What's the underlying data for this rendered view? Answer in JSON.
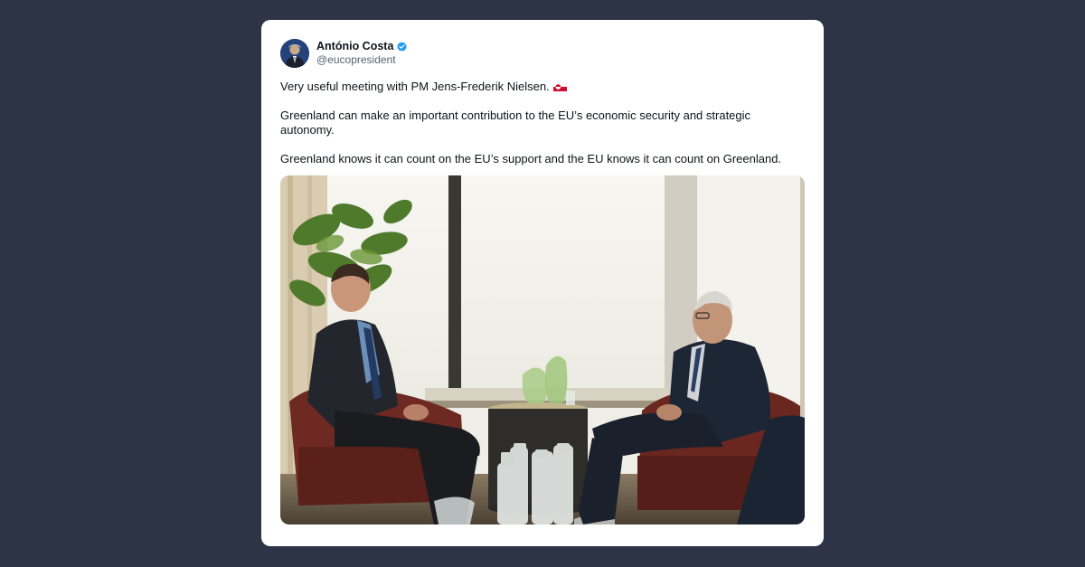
{
  "author": {
    "display_name": "António Costa",
    "handle": "@eucopresident",
    "verified": true,
    "avatar_icon": "portrait-avatar-icon",
    "verified_icon": "verified-badge-icon"
  },
  "tweet": {
    "paragraphs": [
      "Very useful meeting with PM Jens-Frederik Nielsen.",
      "Greenland can make an important contribution to the EU’s economic security and strategic autonomy.",
      "Greenland knows it can count on the EU’s support and the EU knows it can count on Greenland."
    ],
    "flag_icon": "greenland-flag-icon"
  },
  "media": {
    "type": "photo",
    "subject_icon": "meeting-photo"
  },
  "colors": {
    "background": "#2d3445",
    "card": "#ffffff",
    "verified_blue": "#1d9bf0",
    "text": "#0f1419",
    "handle": "#536471",
    "flag_red": "#d00c33"
  }
}
